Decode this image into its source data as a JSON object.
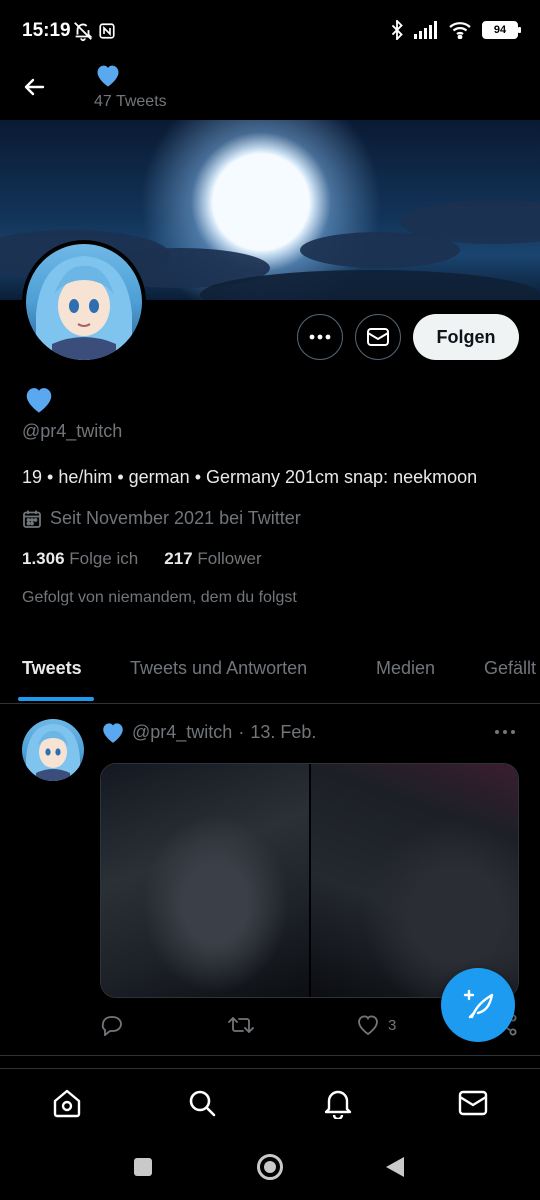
{
  "status_bar": {
    "time": "15:19",
    "battery": "94"
  },
  "header": {
    "tweet_count": "47 Tweets"
  },
  "profile": {
    "handle": "@pr4_twitch",
    "bio": "19 • he/him • german • Germany 201cm  snap: neekmoon",
    "joined": "Seit November 2021 bei Twitter",
    "following_count": "1.306",
    "following_label": "Folge ich",
    "followers_count": "217",
    "followers_label": "Follower",
    "followed_by": "Gefolgt von niemandem, dem du folgst",
    "follow_button": "Folgen"
  },
  "tabs": [
    "Tweets",
    "Tweets und Antworten",
    "Medien",
    "Gefällt mir"
  ],
  "tweet": {
    "handle": "@pr4_twitch",
    "separator": "·",
    "date": "13. Feb.",
    "like_count": "3"
  },
  "colors": {
    "accent": "#1d9bf0",
    "heart": "#5aa8f0",
    "muted": "#71767b",
    "background": "#000000"
  },
  "icons": {
    "back": "arrow-left-icon",
    "more": "more-dots-icon",
    "message": "envelope-icon",
    "calendar": "calendar-icon",
    "reply": "reply-icon",
    "retweet": "retweet-icon",
    "like": "heart-outline-icon",
    "share": "share-icon",
    "compose": "compose-tweet-icon",
    "home": "home-icon",
    "search": "search-icon",
    "notifications": "bell-icon",
    "messages": "envelope-icon"
  }
}
